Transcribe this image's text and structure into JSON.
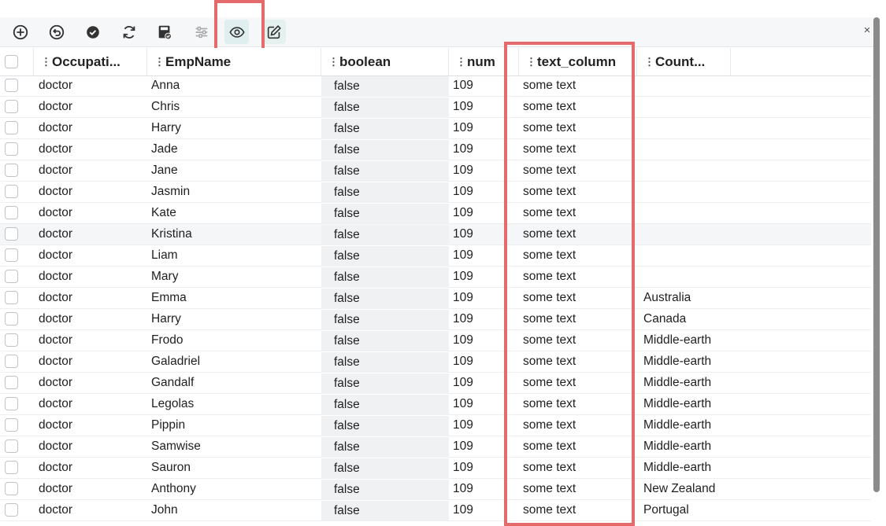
{
  "toolbar": {
    "buttons": [
      {
        "name": "add-row-icon"
      },
      {
        "name": "undo-icon"
      },
      {
        "name": "check-icon"
      },
      {
        "name": "refresh-icon"
      },
      {
        "name": "save-icon"
      },
      {
        "name": "filter-sliders-icon"
      },
      {
        "name": "eye-icon"
      },
      {
        "name": "edit-icon"
      }
    ],
    "close_label": "×"
  },
  "columns": [
    {
      "key": "occupation",
      "label": "Occupati..."
    },
    {
      "key": "empname",
      "label": "EmpName"
    },
    {
      "key": "boolean",
      "label": "boolean"
    },
    {
      "key": "num",
      "label": "num"
    },
    {
      "key": "text_column",
      "label": "text_column"
    },
    {
      "key": "country",
      "label": "Count..."
    }
  ],
  "rows": [
    {
      "occupation": "doctor",
      "empname": "Anna",
      "boolean": "false",
      "num": "109",
      "text_column": "some text",
      "country": ""
    },
    {
      "occupation": "doctor",
      "empname": "Chris",
      "boolean": "false",
      "num": "109",
      "text_column": "some text",
      "country": ""
    },
    {
      "occupation": "doctor",
      "empname": "Harry",
      "boolean": "false",
      "num": "109",
      "text_column": "some text",
      "country": ""
    },
    {
      "occupation": "doctor",
      "empname": "Jade",
      "boolean": "false",
      "num": "109",
      "text_column": "some text",
      "country": ""
    },
    {
      "occupation": "doctor",
      "empname": "Jane",
      "boolean": "false",
      "num": "109",
      "text_column": "some text",
      "country": ""
    },
    {
      "occupation": "doctor",
      "empname": "Jasmin",
      "boolean": "false",
      "num": "109",
      "text_column": "some text",
      "country": ""
    },
    {
      "occupation": "doctor",
      "empname": "Kate",
      "boolean": "false",
      "num": "109",
      "text_column": "some text",
      "country": ""
    },
    {
      "occupation": "doctor",
      "empname": "Kristina",
      "boolean": "false",
      "num": "109",
      "text_column": "some text",
      "country": ""
    },
    {
      "occupation": "doctor",
      "empname": "Liam",
      "boolean": "false",
      "num": "109",
      "text_column": "some text",
      "country": ""
    },
    {
      "occupation": "doctor",
      "empname": "Mary",
      "boolean": "false",
      "num": "109",
      "text_column": "some text",
      "country": ""
    },
    {
      "occupation": "doctor",
      "empname": "Emma",
      "boolean": "false",
      "num": "109",
      "text_column": "some text",
      "country": "Australia"
    },
    {
      "occupation": "doctor",
      "empname": "Harry",
      "boolean": "false",
      "num": "109",
      "text_column": "some text",
      "country": "Canada"
    },
    {
      "occupation": "doctor",
      "empname": "Frodo",
      "boolean": "false",
      "num": "109",
      "text_column": "some text",
      "country": "Middle-earth"
    },
    {
      "occupation": "doctor",
      "empname": "Galadriel",
      "boolean": "false",
      "num": "109",
      "text_column": "some text",
      "country": "Middle-earth"
    },
    {
      "occupation": "doctor",
      "empname": "Gandalf",
      "boolean": "false",
      "num": "109",
      "text_column": "some text",
      "country": "Middle-earth"
    },
    {
      "occupation": "doctor",
      "empname": "Legolas",
      "boolean": "false",
      "num": "109",
      "text_column": "some text",
      "country": "Middle-earth"
    },
    {
      "occupation": "doctor",
      "empname": "Pippin",
      "boolean": "false",
      "num": "109",
      "text_column": "some text",
      "country": "Middle-earth"
    },
    {
      "occupation": "doctor",
      "empname": "Samwise",
      "boolean": "false",
      "num": "109",
      "text_column": "some text",
      "country": "Middle-earth"
    },
    {
      "occupation": "doctor",
      "empname": "Sauron",
      "boolean": "false",
      "num": "109",
      "text_column": "some text",
      "country": "Middle-earth"
    },
    {
      "occupation": "doctor",
      "empname": "Anthony",
      "boolean": "false",
      "num": "109",
      "text_column": "some text",
      "country": "New Zealand"
    },
    {
      "occupation": "doctor",
      "empname": "John",
      "boolean": "false",
      "num": "109",
      "text_column": "some text",
      "country": "Portugal"
    }
  ],
  "highlighted_row": 7,
  "colors": {
    "highlight_box": "#e46a6c",
    "accent": "#2a9d8f"
  }
}
